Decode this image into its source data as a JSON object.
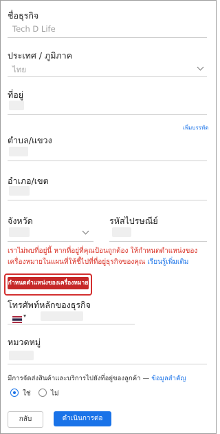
{
  "business_name": {
    "label": "ชื่อธุรกิจ",
    "value": "Tech D Life"
  },
  "country": {
    "label": "ประเทศ / ภูมิภาค",
    "value": "ไทย"
  },
  "address": {
    "label": "ที่อยู่",
    "add_line_link": "เพิ่มบรรทัด"
  },
  "subdistrict": {
    "label": "ตำบล/แขวง"
  },
  "district": {
    "label": "อำเภอ/เขต"
  },
  "province": {
    "label": "จังหวัด"
  },
  "postal_code": {
    "label": "รหัสไปรษณีย์"
  },
  "warning": {
    "text": "เราไม่พบที่อยู่นี้ หากที่อยู่ที่คุณป้อนถูกต้อง ให้กำหนดตำแหน่งของเครื่องหมายในแผนที่ให้ชี้ไปที่ที่อยู่ธุรกิจของคุณ",
    "learn_more": "เรียนรู้เพิ่มเติม"
  },
  "set_marker_button": "กำหนดตำแหน่งของเครื่องหมาย",
  "phone": {
    "label": "โทรศัพท์หลักของธุรกิจ",
    "flag": "thailand-flag-icon"
  },
  "category": {
    "label": "หมวดหมู่"
  },
  "delivery": {
    "question": "มีการจัดส่งสินค้าและบริการไปยังที่อยู่ของลูกค้า —",
    "important_link": "ข้อมูลสำคัญ",
    "yes": "ใช่",
    "no": "ไม่"
  },
  "buttons": {
    "back": "กลับ",
    "next": "ดำเนินการต่อ"
  },
  "colors": {
    "accent": "#1a73e8",
    "error": "#d93025",
    "marker_button": "#c62828"
  }
}
